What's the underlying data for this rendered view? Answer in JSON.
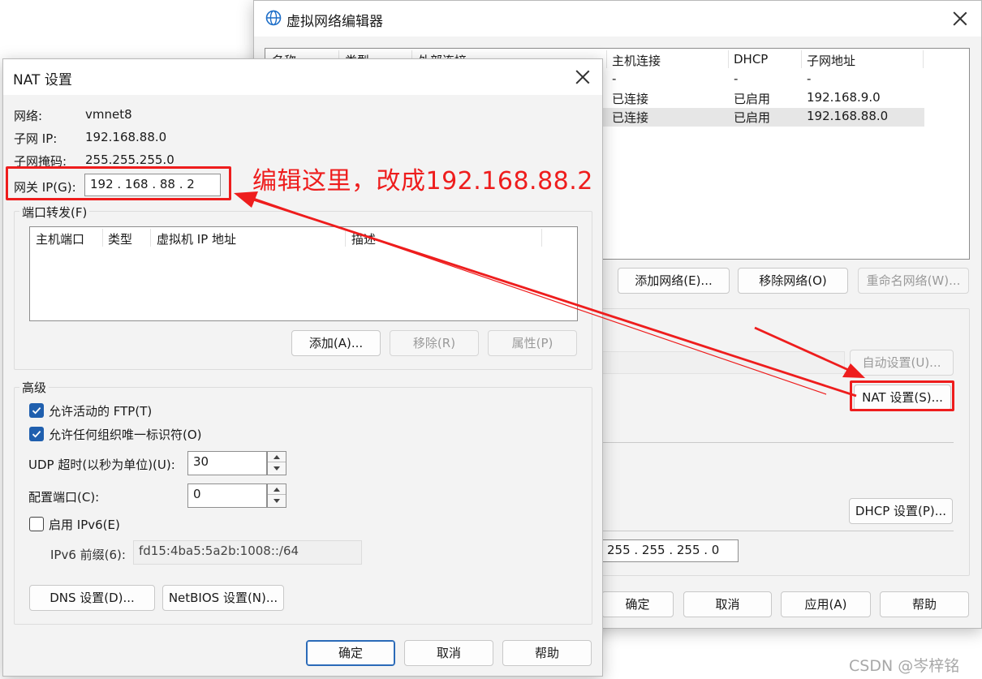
{
  "vne": {
    "title": "虚拟网络编辑器",
    "columns": [
      "名称",
      "类型",
      "外部连接",
      "主机连接",
      "DHCP",
      "子网地址"
    ],
    "rows": [
      {
        "host": "-",
        "dhcp": "-",
        "subnet": "-"
      },
      {
        "host": "已连接",
        "dhcp": "已启用",
        "subnet": "192.168.9.0"
      },
      {
        "host": "已连接",
        "dhcp": "已启用",
        "subnet": "192.168.88.0"
      }
    ],
    "add_network": "添加网络(E)...",
    "remove_network": "移除网络(O)",
    "rename_network": "重命名网络(W)...",
    "auto_setup": "自动设置(U)...",
    "nat_settings": "NAT 设置(S)...",
    "dhcp_settings": "DHCP 设置(P)...",
    "subnet_mask_value": "255 . 255 . 255 .  0",
    "ok": "确定",
    "cancel": "取消",
    "apply": "应用(A)",
    "help": "帮助"
  },
  "nat": {
    "title": "NAT 设置",
    "network_label": "网络:",
    "network_value": "vmnet8",
    "subnet_ip_label": "子网 IP:",
    "subnet_ip_value": "192.168.88.0",
    "subnet_mask_label": "子网掩码:",
    "subnet_mask_value": "255.255.255.0",
    "gateway_label": "网关 IP(G):",
    "gateway_value": "192 . 168 . 88  .  2",
    "port_forward_title": "端口转发(F)",
    "pf_columns": [
      "主机端口",
      "类型",
      "虚拟机 IP 地址",
      "描述"
    ],
    "add": "添加(A)...",
    "remove": "移除(R)",
    "properties": "属性(P)",
    "advanced_title": "高级",
    "allow_ftp": "允许活动的 FTP(T)",
    "allow_uid": "允许任何组织唯一标识符(O)",
    "udp_label": "UDP 超时(以秒为单位)(U):",
    "udp_value": "30",
    "config_port_label": "配置端口(C):",
    "config_port_value": "0",
    "ipv6_label": "启用 IPv6(E)",
    "ipv6_prefix_label": "IPv6 前缀(6):",
    "ipv6_prefix_value": "fd15:4ba5:5a2b:1008::/64",
    "dns": "DNS 设置(D)...",
    "netbios": "NetBIOS 设置(N)...",
    "ok": "确定",
    "cancel": "取消",
    "help": "帮助"
  },
  "annotation": {
    "text": "编辑这里，改成192.168.88.2",
    "color": "#ee1d1d"
  },
  "watermark": "CSDN @岑梓铭",
  "icons": [
    "globe-icon",
    "close-icon",
    "checkbox-checked-icon",
    "spin-up-icon",
    "spin-down-icon",
    "arrow-annotation"
  ]
}
